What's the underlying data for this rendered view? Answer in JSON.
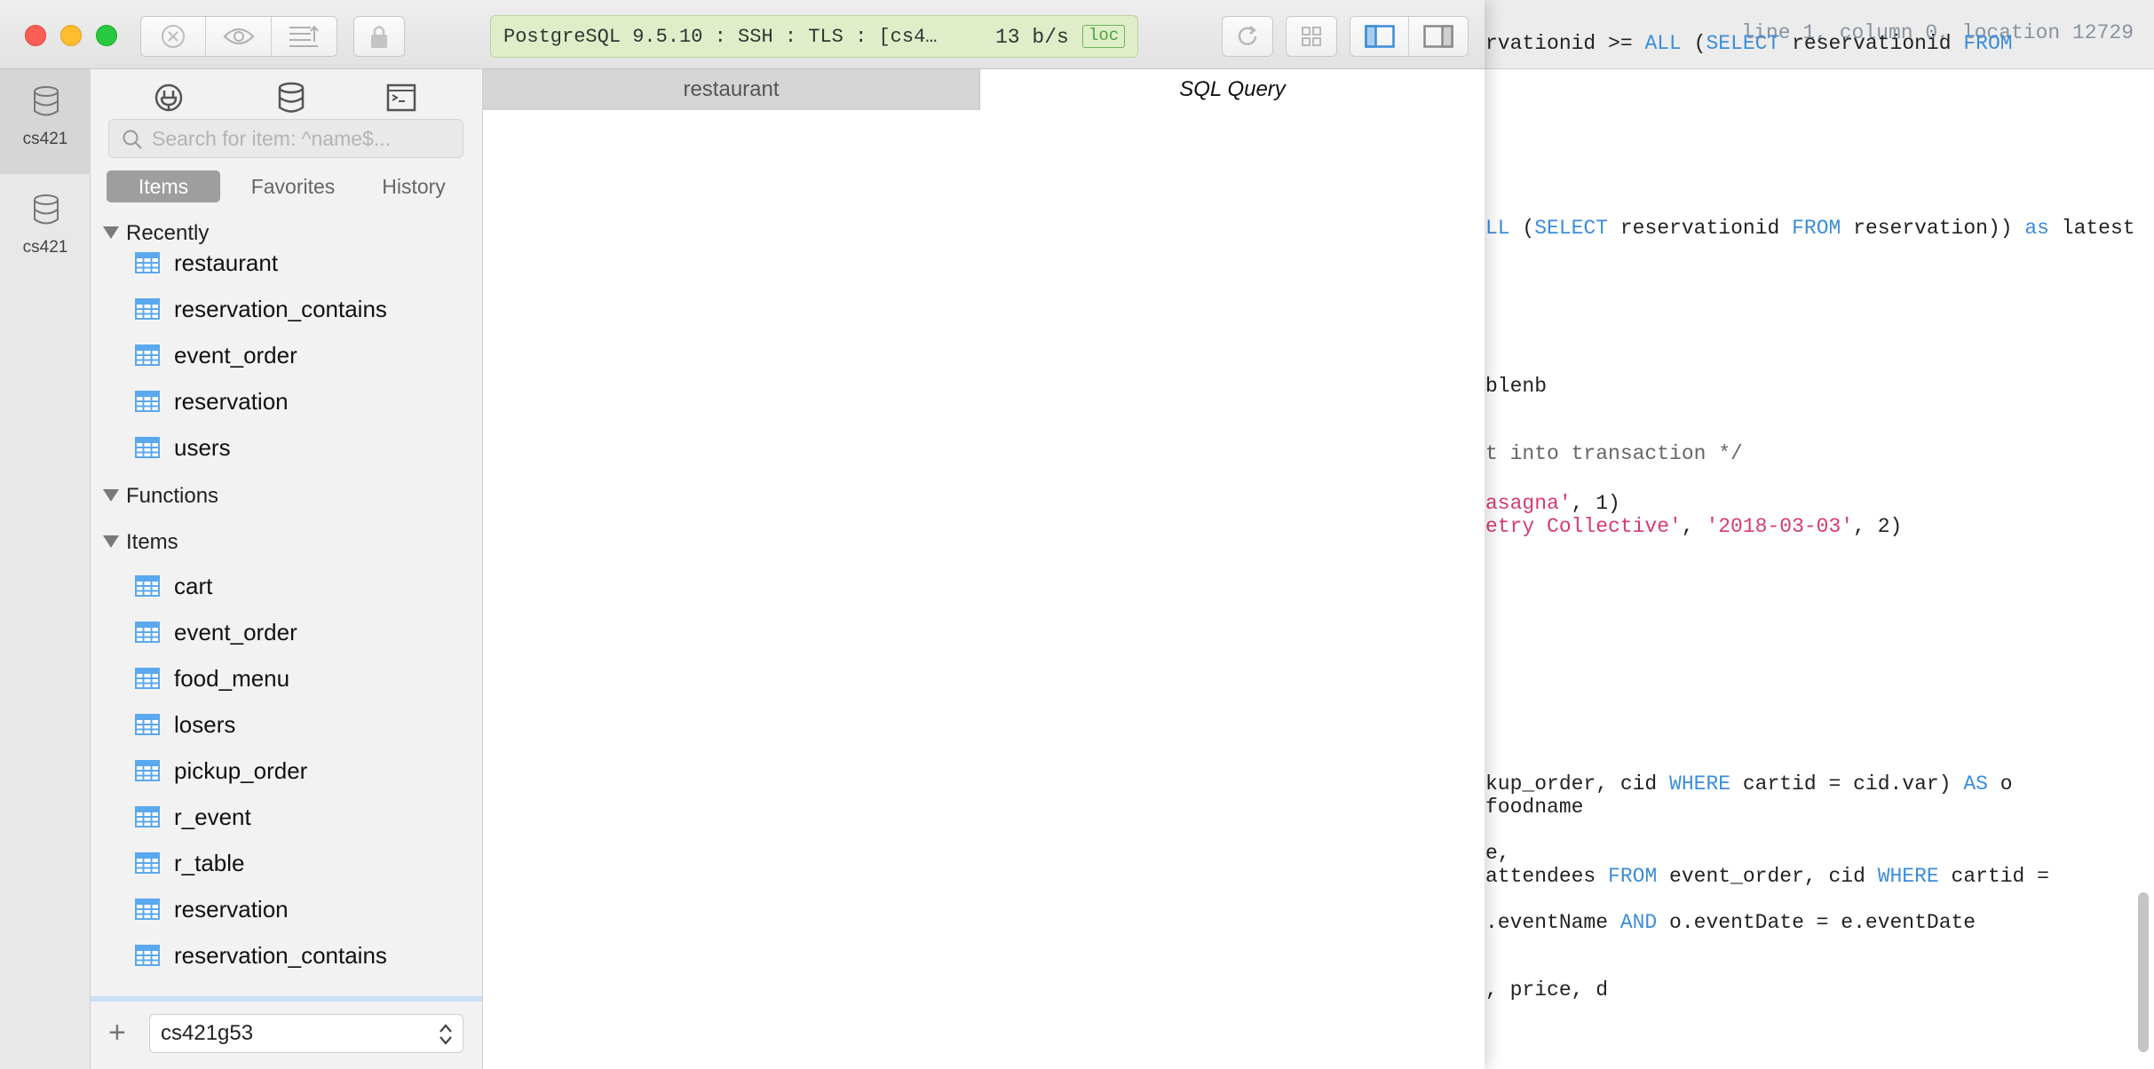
{
  "background_editor": {
    "status": "line 1, column 0, location 12729",
    "lines": [
      [
        [
          "",
          "rvationid >= "
        ],
        [
          "kw",
          "ALL"
        ],
        [
          "",
          " ("
        ],
        [
          "kw",
          "SELECT"
        ],
        [
          "",
          " reservationid "
        ],
        [
          "kw",
          "FROM"
        ]
      ],
      [
        [
          "kw",
          "LL"
        ],
        [
          "",
          " ("
        ],
        [
          "kw",
          "SELECT"
        ],
        [
          "",
          " reservationid "
        ],
        [
          "kw",
          "FROM"
        ],
        [
          "",
          " reservation)) "
        ],
        [
          "kw",
          "as"
        ],
        [
          "",
          " latest"
        ]
      ],
      [
        [
          "",
          "blenb"
        ]
      ],
      [
        [
          "cm",
          "t into transaction */"
        ]
      ],
      [
        [
          "str",
          "asagna'"
        ],
        [
          "",
          ", 1)"
        ]
      ],
      [
        [
          "str",
          "etry Collective'"
        ],
        [
          "",
          ", "
        ],
        [
          "str",
          "'2018-03-03'"
        ],
        [
          "",
          ", 2)"
        ]
      ],
      [
        [
          "",
          "kup_order, cid "
        ],
        [
          "kw",
          "WHERE"
        ],
        [
          "",
          " cartid = cid.var) "
        ],
        [
          "kw",
          "AS"
        ],
        [
          "",
          " o"
        ]
      ],
      [
        [
          "",
          "foodname"
        ]
      ],
      [
        [
          "",
          "e,"
        ]
      ],
      [
        [
          "",
          "attendees "
        ],
        [
          "kw",
          "FROM"
        ],
        [
          "",
          " event_order, cid "
        ],
        [
          "kw",
          "WHERE"
        ],
        [
          "",
          " cartid ="
        ]
      ],
      [
        [
          "",
          ".eventName "
        ],
        [
          "kw",
          "AND"
        ],
        [
          "",
          " o.eventDate = e.eventDate"
        ]
      ],
      [
        [
          "",
          ", price, d"
        ]
      ]
    ]
  },
  "titlebar": {
    "connection_text": "PostgreSQL 9.5.10 : SSH : TLS : [cs4…",
    "rate": "13 b/s",
    "badge": "loc"
  },
  "connections": [
    {
      "label": "cs421",
      "active": true
    },
    {
      "label": "cs421",
      "active": false
    }
  ],
  "sidebar": {
    "search_placeholder": "Search for item: ^name$...",
    "filter_tabs": [
      "Items",
      "Favorites",
      "History"
    ],
    "groups": [
      {
        "title": "Recently",
        "items": [
          "restaurant",
          "reservation_contains",
          "event_order",
          "reservation",
          "users"
        ]
      },
      {
        "title": "Functions",
        "items": []
      },
      {
        "title": "Items",
        "items": [
          "cart",
          "event_order",
          "food_menu",
          "losers",
          "pickup_order",
          "r_event",
          "r_table",
          "reservation",
          "reservation_contains"
        ]
      }
    ],
    "database": "cs421g53"
  },
  "tabs": [
    "restaurant",
    "SQL Query"
  ],
  "colors": {
    "accent_blue": "#3b8dd9",
    "string_red": "#d63c6b",
    "connection_green": "#dfeec9"
  }
}
